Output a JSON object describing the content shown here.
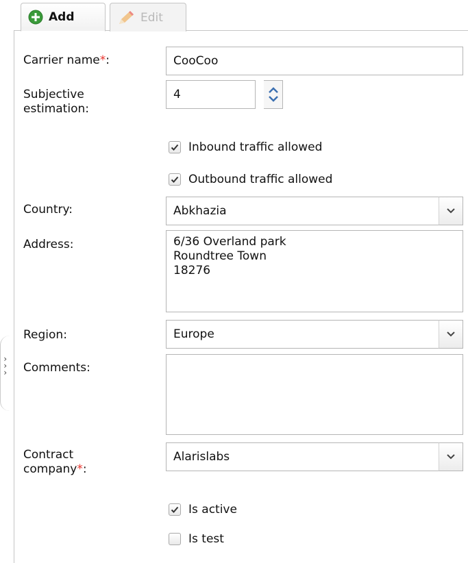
{
  "tabs": {
    "add_label": "Add",
    "edit_label": "Edit",
    "add_icon": "plus-circle-icon",
    "edit_icon": "pencil-icon"
  },
  "form": {
    "carrier_name": {
      "label": "Carrier name",
      "required_mark": "*",
      "suffix": ":",
      "value": "CooCoo"
    },
    "subjective_estimation": {
      "label_line1": "Subjective",
      "label_line2": "estimation:",
      "value": "4"
    },
    "inbound": {
      "label": "Inbound traffic allowed",
      "checked": true
    },
    "outbound": {
      "label": "Outbound traffic allowed",
      "checked": true
    },
    "country": {
      "label": "Country:",
      "value": "Abkhazia"
    },
    "address": {
      "label": "Address:",
      "value": "6/36 Overland park\nRoundtree Town\n18276"
    },
    "region": {
      "label": "Region:",
      "value": "Europe"
    },
    "comments": {
      "label": "Comments:",
      "value": ""
    },
    "contract_company": {
      "label_line1": "Contract",
      "label_line2": "company",
      "required_mark": "*",
      "suffix": ":",
      "value": "Alarislabs"
    },
    "is_active": {
      "label": "Is active",
      "checked": true
    },
    "is_test": {
      "label": "Is test",
      "checked": false
    }
  },
  "colors": {
    "required": "#e8322b",
    "add_icon_green": "#3a9a3a",
    "edit_icon_orange": "#f0a13a",
    "spinner_arrow": "#3a6fb0"
  },
  "panel_toggle_icon": "chevron-right-icon"
}
